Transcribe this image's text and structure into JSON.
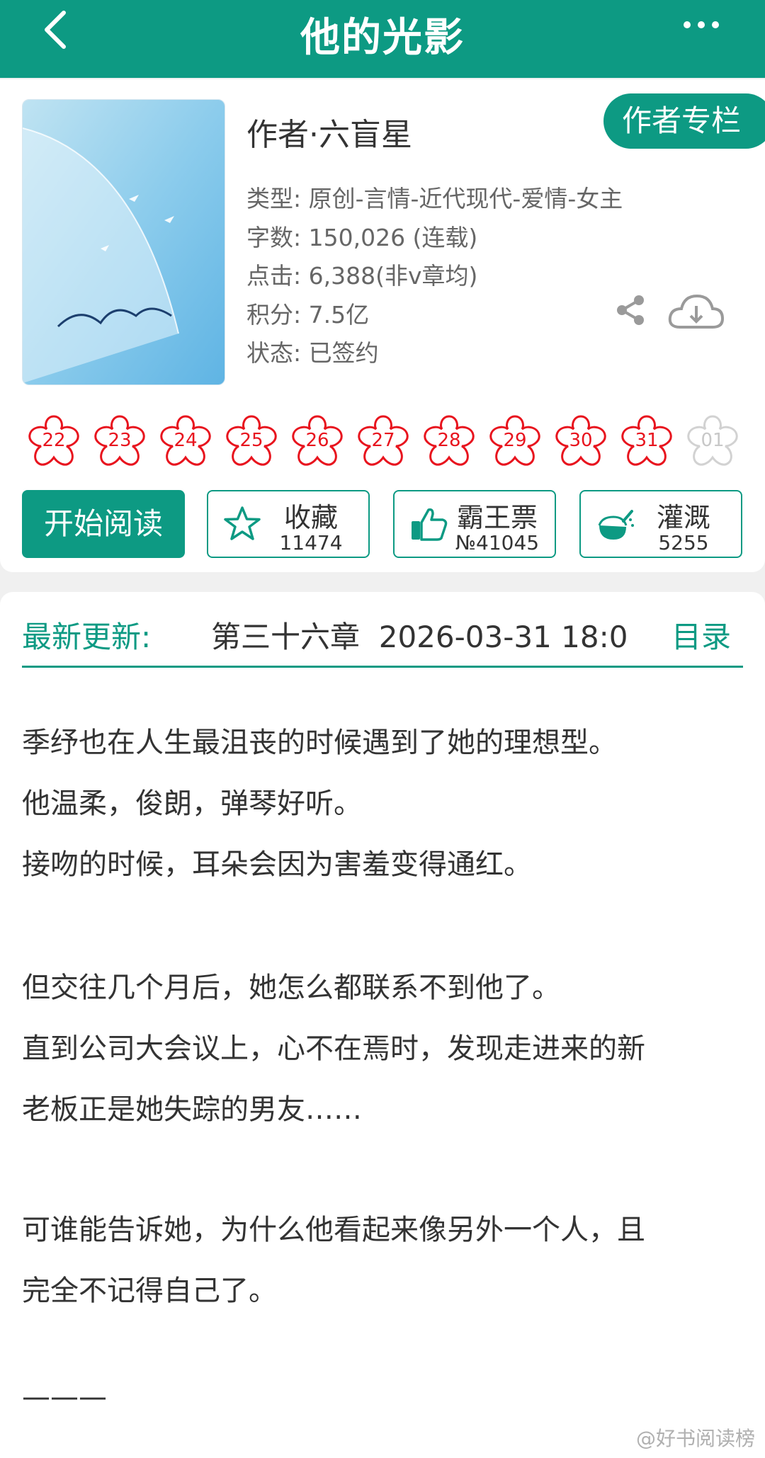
{
  "header": {
    "title": "他的光影"
  },
  "book": {
    "author": "作者·六盲星",
    "author_column_btn": "作者专栏",
    "meta": [
      "类型: 原创-言情-近代现代-爱情-女主",
      "字数: 150,026 (连载)",
      "点击: 6,388(非v章均)",
      "积分: 7.5亿",
      "状态: 已签约"
    ]
  },
  "flowers": [
    "22",
    "23",
    "24",
    "25",
    "26",
    "27",
    "28",
    "29",
    "30",
    "31",
    "01"
  ],
  "actions": {
    "read": "开始阅读",
    "collect": {
      "label": "收藏",
      "count": "11474"
    },
    "ticket": {
      "label": "霸王票",
      "count": "№41045"
    },
    "water": {
      "label": "灌溉",
      "count": "5255"
    }
  },
  "update": {
    "label": "最新更新:",
    "chapter": "第三十六章",
    "time": "2026-03-31 18:0",
    "toc": "目录"
  },
  "description": [
    "季纾也在人生最沮丧的时候遇到了她的理想型。",
    "他温柔，俊朗，弹琴好听。",
    "接吻的时候，耳朵会因为害羞变得通红。",
    "但交往几个月后，她怎么都联系不到他了。",
    "直到公司大会议上，心不在焉时，发现走进来的新",
    "老板正是她失踪的男友……",
    "可谁能告诉她，为什么他看起来像另外一个人，且",
    "完全不记得自己了。",
    "———"
  ],
  "watermark": "@好书阅读榜",
  "colors": {
    "accent": "#0d9a83",
    "flower": "#e8141e"
  }
}
